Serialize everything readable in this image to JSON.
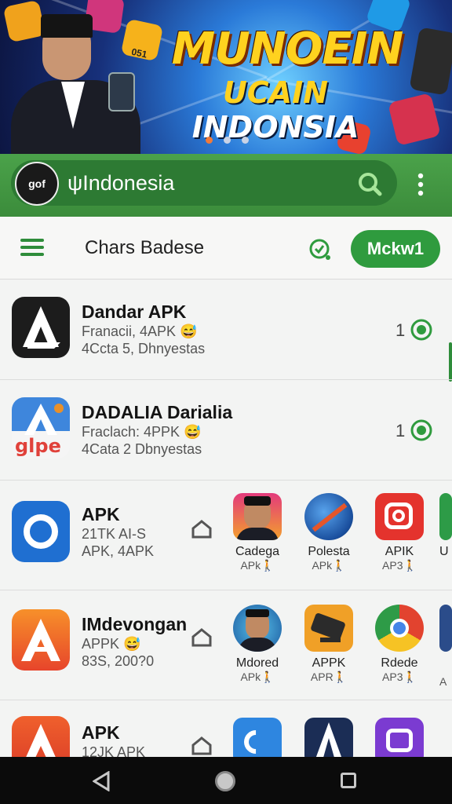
{
  "banner": {
    "title": "MUNOEIN",
    "subtitle_part1": "UCAIN",
    "subtitle_part2": "INDONSIA",
    "tile_text": "051",
    "carousel_dots": 3,
    "active_dot": 0
  },
  "search": {
    "avatar_text": "gof",
    "value": "ψIndonesia",
    "icons": [
      "search-icon",
      "more-vertical-icon"
    ]
  },
  "toolbar": {
    "title": "Chars Badese",
    "button_label": "Mckw1",
    "icons": [
      "menu-icon",
      "verified-check-icon"
    ]
  },
  "rows": [
    {
      "title": "Dandar APK",
      "line1": "Franacii, 4APK 😅",
      "line2": "4Ccta 5, Dhnyestas",
      "count": "1"
    },
    {
      "title": "DADALIA Darialia",
      "line1": "Fraclach: 4PPK 😅",
      "line2": "4Cata 2 Dbnyestas",
      "count": "1"
    },
    {
      "title": "APK",
      "line1": "21TK AI-S",
      "line2": "APK, 4APK",
      "minis": [
        {
          "label": "Cadega",
          "sub": "APk🚶"
        },
        {
          "label": "Polesta",
          "sub": "APk🚶"
        },
        {
          "label": "APIK",
          "sub": "AP3🚶"
        },
        {
          "label": "U",
          "sub": ""
        }
      ]
    },
    {
      "title": "IMdevongan",
      "line1": "APPK 😅",
      "line2": "83S, 200?0",
      "minis": [
        {
          "label": "Mdored",
          "sub": "APk🚶"
        },
        {
          "label": "APPK",
          "sub": "APR🚶"
        },
        {
          "label": "Rdede",
          "sub": "AP3🚶"
        },
        {
          "label": "",
          "sub": "A"
        }
      ]
    },
    {
      "title": "APK",
      "line1": "12JK APK",
      "line2": ""
    }
  ],
  "navbar": {
    "icons": [
      "back-icon",
      "home-icon",
      "recents-icon"
    ]
  },
  "colors": {
    "primary_green": "#2f9b3e",
    "banner_gold": "#ffd21f",
    "banner_blue": "#17307a"
  }
}
